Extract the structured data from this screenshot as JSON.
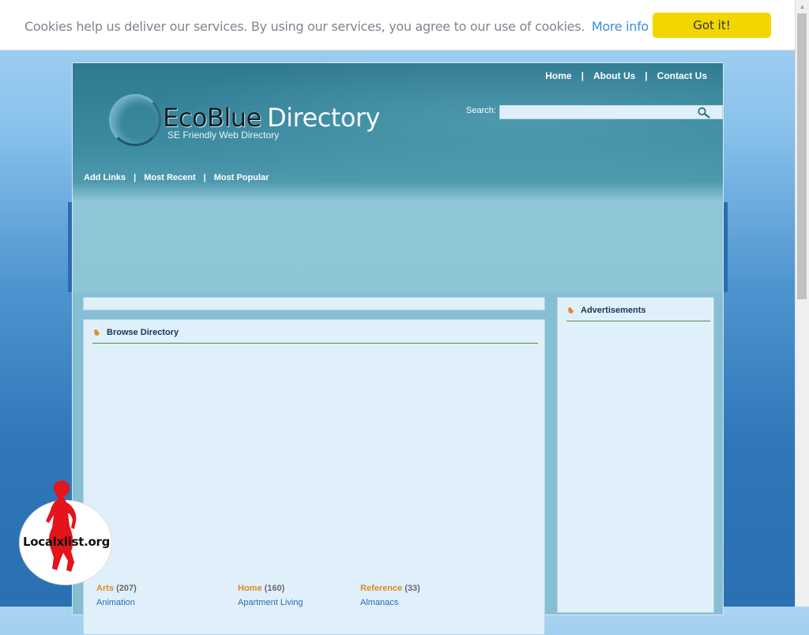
{
  "cookie": {
    "message": "Cookies help us deliver our services. By using our services, you agree to our use of cookies.",
    "more_info": "More info",
    "button": "Got it!"
  },
  "top_nav": [
    "Home",
    "About Us",
    "Contact Us"
  ],
  "top_nav_separator": "|",
  "logo": {
    "eco": "EcoBlue",
    "directory": "Directory",
    "tagline": "SE Friendly Web Directory"
  },
  "search": {
    "label": "Search:",
    "placeholder": ""
  },
  "sub_nav": [
    "Add Links",
    "Most Recent",
    "Most Popular"
  ],
  "panels": {
    "browse_title": "Browse Directory",
    "ads_title": "Advertisements"
  },
  "categories": [
    {
      "title": "Arts",
      "count": "(207)",
      "first_sub": "Animation"
    },
    {
      "title": "Home",
      "count": "(160)",
      "first_sub": "Apartment Living"
    },
    {
      "title": "Reference",
      "count": "(33)",
      "first_sub": "Almanacs"
    }
  ],
  "watermark": {
    "text": "Localxlist.org"
  },
  "colors": {
    "accent_orange": "#d98b1f",
    "link_blue": "#2a6db1",
    "cookie_button": "#f1d600",
    "panel_bg": "#e0f0fb",
    "rule_green": "#4f8a3d"
  }
}
